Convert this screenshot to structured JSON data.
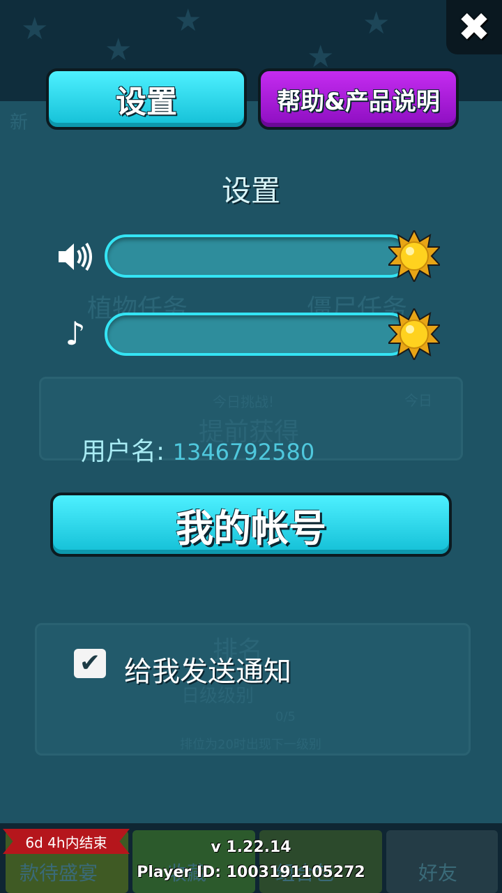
{
  "top": {
    "close_label": "✖"
  },
  "tabs": {
    "settings_label": "设置",
    "help_label": "帮助&产品说明"
  },
  "settings": {
    "title": "设置",
    "sound_icon": "🔊",
    "sound_level": 1.0,
    "music_icon": "♪",
    "music_level": 1.0
  },
  "account": {
    "username_label": "用户名:",
    "username_value": "1346792580",
    "account_button_label": "我的帐号"
  },
  "notifications": {
    "checked": true,
    "check_glyph": "✔",
    "label": "给我发送通知"
  },
  "background": {
    "ghost_texts": [
      "新",
      "植物任务",
      "僵尸任务",
      "今日挑战!",
      "提前获得",
      "今日",
      "排名",
      "日级级别",
      "0/5",
      "排位为20时出现下一级别"
    ],
    "bottom_event_tag": "6d 4h内结束",
    "bottom_labels": [
      "款待盛宴",
      "收藏",
      "组合包",
      "好友"
    ]
  },
  "footer": {
    "version": "v 1.22.14",
    "player_id": "Player ID: 1003191105272"
  },
  "colors": {
    "cyan": "#1fd3ea",
    "purple": "#a81bdc",
    "panel": "#1e5364",
    "track": "#34e4f4",
    "sun": "#ffd21f"
  }
}
